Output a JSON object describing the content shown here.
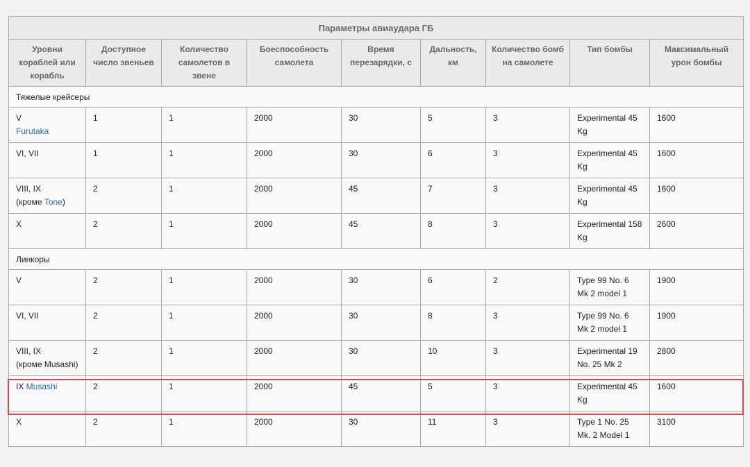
{
  "table": {
    "caption": "Параметры авиаудара ГБ",
    "headers": [
      "Уровни кораблей или корабль",
      "Доступное число звеньев",
      "Количество самолетов в звене",
      "Боеспособность самолета",
      "Время перезарядки, с",
      "Дальность, км",
      "Количество бомб на самолете",
      "Тип бомбы",
      "Максимальный урон бомбы"
    ],
    "groups": [
      {
        "name": "Тяжелые крейсеры",
        "rows": [
          {
            "tier": "V",
            "link": "Furutaka",
            "flights": "1",
            "planes": "1",
            "hp": "2000",
            "reload": "30",
            "range": "5",
            "bombs": "3",
            "bomb_type": "Experimental 45 Kg",
            "damage": "1600"
          },
          {
            "tier": "VI, VII",
            "flights": "1",
            "planes": "1",
            "hp": "2000",
            "reload": "30",
            "range": "6",
            "bombs": "3",
            "bomb_type": "Experimental 45 Kg",
            "damage": "1600"
          },
          {
            "tier": "VIII, IX",
            "note_pre": "(кроме ",
            "link": "Tone",
            "note_post": ")",
            "flights": "2",
            "planes": "1",
            "hp": "2000",
            "reload": "45",
            "range": "7",
            "bombs": "3",
            "bomb_type": "Experimental 45 Kg",
            "damage": "1600"
          },
          {
            "tier": "X",
            "flights": "2",
            "planes": "1",
            "hp": "2000",
            "reload": "45",
            "range": "8",
            "bombs": "3",
            "bomb_type": "Experimental 158 Kg",
            "damage": "2600"
          }
        ]
      },
      {
        "name": "Линкоры",
        "rows": [
          {
            "tier": "V",
            "flights": "2",
            "planes": "1",
            "hp": "2000",
            "reload": "30",
            "range": "6",
            "bombs": "2",
            "bomb_type": "Type 99 No. 6 Mk 2 model 1",
            "damage": "1900"
          },
          {
            "tier": "VI, VII",
            "flights": "2",
            "planes": "1",
            "hp": "2000",
            "reload": "30",
            "range": "8",
            "bombs": "3",
            "bomb_type": "Type 99 No. 6 Mk 2 model 1",
            "damage": "1900"
          },
          {
            "tier": "VIII, IX",
            "note": "(кроме Musashi)",
            "flights": "2",
            "planes": "1",
            "hp": "2000",
            "reload": "30",
            "range": "10",
            "bombs": "3",
            "bomb_type": "Experimental 19 No. 25 Mk 2",
            "damage": "2800"
          },
          {
            "tier_inline": "IX ",
            "link_inline": "Musashi",
            "highlighted": true,
            "flights": "2",
            "planes": "1",
            "hp": "2000",
            "reload": "45",
            "range": "5",
            "bombs": "3",
            "bomb_type": "Experimental 45 Kg",
            "damage": "1600"
          },
          {
            "tier": "X",
            "flights": "2",
            "planes": "1",
            "hp": "2000",
            "reload": "30",
            "range": "11",
            "bombs": "3",
            "bomb_type": "Type 1 No. 25 Mk. 2 Model 1",
            "damage": "3100"
          }
        ]
      }
    ]
  },
  "colors": {
    "link": "#2a6ab0",
    "highlight_border": "#d64b4b",
    "header_bg": "#eaeaea",
    "cell_border": "#a8a8a8"
  }
}
